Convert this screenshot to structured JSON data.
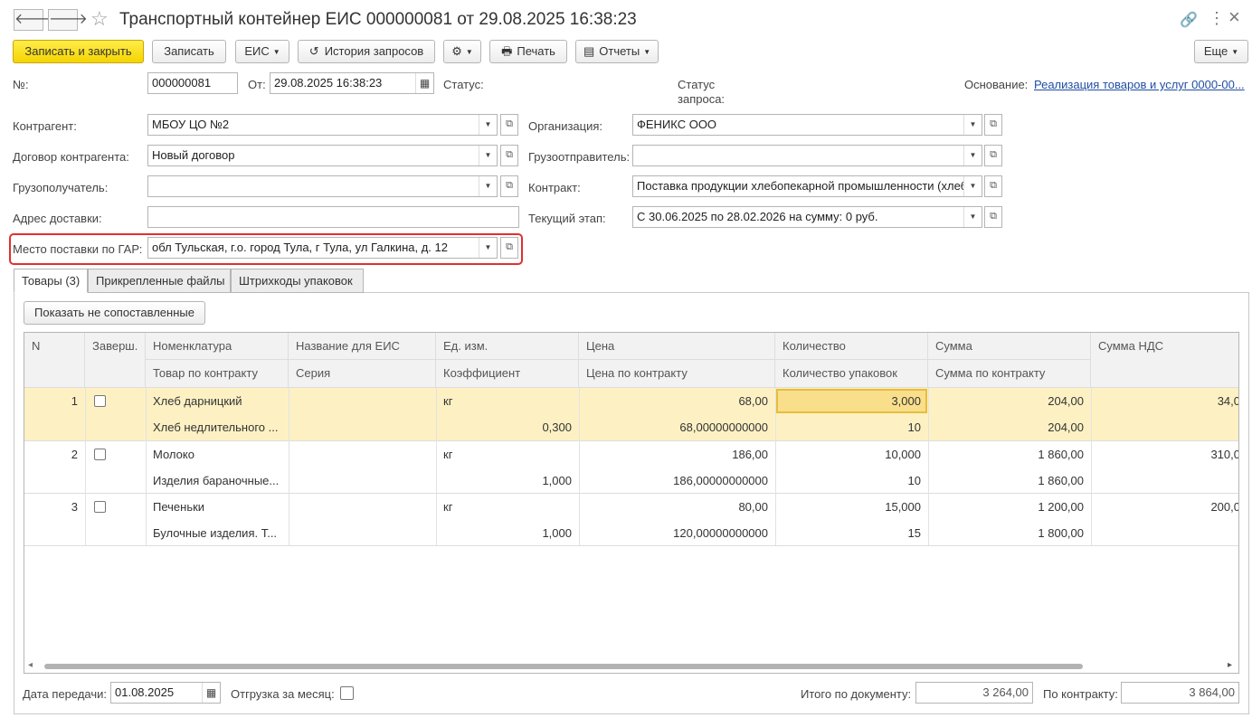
{
  "window": {
    "title": "Транспортный контейнер ЕИС 000000081 от 29.08.2025 16:38:23",
    "back": "🡐",
    "forward": "🡒",
    "star": "☆",
    "link": "🔗",
    "more": "⋮",
    "close": "×"
  },
  "toolbar": {
    "save_close": "Записать и закрыть",
    "save": "Записать",
    "eis": "ЕИС",
    "history": "История запросов",
    "history_icon": "↺",
    "gear": "⚙",
    "print": "Печать",
    "print_icon": "🖶",
    "reports": "Отчеты",
    "reports_icon": "▤",
    "more": "Еще",
    "caret": "▼"
  },
  "header": {
    "number_label": "№:",
    "number": "000000081",
    "from_label": "От:",
    "date": "29.08.2025 16:38:23",
    "calendar_icon": "▦",
    "status_label": "Статус:",
    "request_status_label": "Статус запроса:",
    "basis_label": "Основание:",
    "basis_link": "Реализация товаров и услуг 0000-00..."
  },
  "form": {
    "counterparty_label": "Контрагент:",
    "counterparty": "МБОУ ЦО №2",
    "contract_label": "Договор контрагента:",
    "contract": "Новый договор",
    "consignee_label": "Грузополучатель:",
    "consignee": "",
    "address_label": "Адрес доставки:",
    "address": "",
    "gar_label": "Место поставки по ГАР:",
    "gar": "обл Тульская, г.о. город Тула, г Тула, ул Галкина, д. 12",
    "org_label": "Организация:",
    "org": "ФЕНИКС ООО",
    "shipper_label": "Грузоотправитель:",
    "shipper": "",
    "gov_contract_label": "Контракт:",
    "gov_contract": "Поставка продукции хлебопекарной промышленности (хлеб",
    "stage_label": "Текущий этап:",
    "stage": "С 30.06.2025 по 28.02.2026 на сумму: 0 руб.",
    "dd": "▼",
    "open": "⧉",
    "highlight_color": "#e03030"
  },
  "tabs": [
    "Товары (3)",
    "Прикрепленные файлы",
    "Штрихкоды упаковок"
  ],
  "table": {
    "show_unmatched": "Показать не сопоставленные",
    "headers": {
      "n": "N",
      "done": "Заверш.",
      "nom": "Номенклатура",
      "nom2": "Товар по контракту",
      "eis": "Название для ЕИС",
      "eis2": "Серия",
      "unit": "Ед. изм.",
      "unit2": "Коэффициент",
      "price": "Цена",
      "price2": "Цена по контракту",
      "qty": "Количество",
      "qty2": "Количество упаковок",
      "sum": "Сумма",
      "sum2": "Сумма по контракту",
      "vat": "Сумма НДС"
    },
    "rows": [
      {
        "n": "1",
        "nom": "Хлеб дарницкий",
        "nom2": "Хлеб недлительного ...",
        "unit": "кг",
        "coef": "0,300",
        "price": "68,00",
        "price2": "68,00000000000",
        "qty": "3,000",
        "qty2": "10",
        "sum": "204,00",
        "sum2": "204,00",
        "vat": "34,0"
      },
      {
        "n": "2",
        "nom": "Молоко",
        "nom2": "Изделия бараночные...",
        "unit": "кг",
        "coef": "1,000",
        "price": "186,00",
        "price2": "186,00000000000",
        "qty": "10,000",
        "qty2": "10",
        "sum": "1 860,00",
        "sum2": "1 860,00",
        "vat": "310,0"
      },
      {
        "n": "3",
        "nom": "Печеньки",
        "nom2": "Булочные изделия. Т...",
        "unit": "кг",
        "coef": "1,000",
        "price": "80,00",
        "price2": "120,00000000000",
        "qty": "15,000",
        "qty2": "15",
        "sum": "1 200,00",
        "sum2": "1 800,00",
        "vat": "200,0"
      }
    ],
    "selected_row_color": "#fdf1c4",
    "selected_cell_color": "#f9df8c",
    "scroll_left": "◂",
    "scroll_right": "▸"
  },
  "footer": {
    "date_label": "Дата передачи:",
    "date": "01.08.2025",
    "monthly_label": "Отгрузка за месяц:",
    "total_label": "Итого по документу:",
    "total": "3 264,00",
    "contract_total_label": "По контракту:",
    "contract_total": "3 864,00"
  }
}
